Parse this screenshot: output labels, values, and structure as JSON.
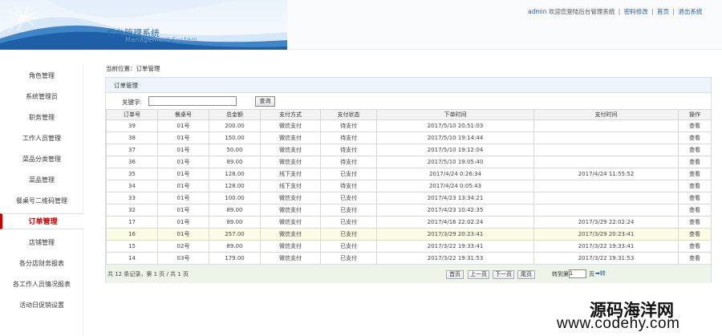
{
  "header": {
    "title": "后台管理系统",
    "subtitle": "Management System",
    "user": "admin",
    "welcome": "欢迎您登陆后台管理系统",
    "links": [
      "密码修改",
      "首页",
      "退出系统"
    ]
  },
  "sidebar": {
    "items": [
      {
        "label": "角色管理"
      },
      {
        "label": "系统管理员"
      },
      {
        "label": "职务管理"
      },
      {
        "label": "工作人员管理"
      },
      {
        "label": "菜品分类管理"
      },
      {
        "label": "菜品管理"
      },
      {
        "label": "餐桌号二维码管理"
      },
      {
        "label": "订单管理"
      },
      {
        "label": "店铺管理"
      },
      {
        "label": "各分店财务报表"
      },
      {
        "label": "各工作人员情况报表"
      },
      {
        "label": "活动日促销设置"
      }
    ],
    "active_index": 7
  },
  "breadcrumb": "当前位置：订单管理",
  "panel": {
    "title": "订单管理",
    "search_label": "关键字:",
    "search_value": "",
    "search_button": "查询"
  },
  "table": {
    "columns": [
      "订单号",
      "餐桌号",
      "总金额",
      "支付方式",
      "支付状态",
      "下单时间",
      "支付时间",
      "操作"
    ],
    "rows": [
      [
        "39",
        "01号",
        "200.00",
        "微信支付",
        "待支付",
        "2017/5/10 20:51:03",
        "",
        "查看"
      ],
      [
        "38",
        "01号",
        "150.00",
        "微信支付",
        "待支付",
        "2017/5/10 19:14:44",
        "",
        "查看"
      ],
      [
        "37",
        "01号",
        "50.00",
        "微信支付",
        "待支付",
        "2017/5/10 19:12:04",
        "",
        "查看"
      ],
      [
        "36",
        "01号",
        "89.00",
        "微信支付",
        "待支付",
        "2017/5/10 19:05:40",
        "",
        "查看"
      ],
      [
        "35",
        "01号",
        "128.00",
        "线下支付",
        "已支付",
        "2017/4/24 0:26:34",
        "2017/4/24 11:55:52",
        "查看"
      ],
      [
        "34",
        "01号",
        "128.00",
        "线下支付",
        "待支付",
        "2017/4/24 0:05:43",
        "",
        "查看"
      ],
      [
        "33",
        "01号",
        "100.00",
        "微信支付",
        "已支付",
        "2017/4/23 13:34:21",
        "",
        "查看"
      ],
      [
        "32",
        "01号",
        "89.00",
        "微信支付",
        "已支付",
        "2017/4/23 10:42:35",
        "",
        "查看"
      ],
      [
        "17",
        "01号",
        "89.00",
        "微信支付",
        "已支付",
        "2017/4/16 22:02:24",
        "2017/3/29 22:02:24",
        "查看"
      ],
      [
        "16",
        "01号",
        "257.00",
        "微信支付",
        "已支付",
        "2017/3/29 20:23:41",
        "2017/3/29 20:23:41",
        "查看"
      ],
      [
        "15",
        "02号",
        "89.00",
        "微信支付",
        "已支付",
        "2017/3/22 19:33:41",
        "2017/3/22 19:33:41",
        "查看"
      ],
      [
        "14",
        "03号",
        "179.00",
        "微信支付",
        "已支付",
        "2017/3/22 19:31:53",
        "2017/3/22 19:31:53",
        "查看"
      ]
    ],
    "highlight_row": 9
  },
  "pager": {
    "info": "共 12 条记录，第 1 页 / 共 1 页",
    "buttons": [
      "首页",
      "上一页",
      "下一页",
      "尾页"
    ],
    "goto_label": "转到第",
    "goto_value": "1",
    "goto_unit": "页",
    "goto_button": "➡转"
  },
  "watermark": {
    "line1": "源码海洋网",
    "line2": "www.codehy.com"
  },
  "colors": {
    "accent": "#2e68a8",
    "unpaid": "#d40000",
    "active_menu": "#c30000"
  }
}
